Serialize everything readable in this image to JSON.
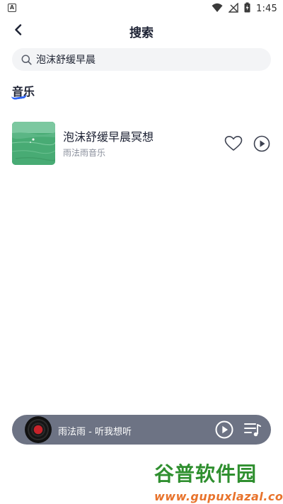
{
  "status_bar": {
    "left_icon_letter": "A",
    "time": "1:45",
    "icons": [
      "wifi-icon",
      "signal-off-icon",
      "battery-charging-icon"
    ]
  },
  "header": {
    "title": "搜索",
    "back_icon": "chevron-left-icon"
  },
  "search": {
    "value": "泡沫舒缓早晨",
    "icon": "search-icon"
  },
  "section": {
    "title": "音乐",
    "accent_color": "#2c63f6"
  },
  "results": [
    {
      "title": "泡沫舒缓早晨冥想",
      "artist": "雨法雨音乐",
      "actions": [
        "heart-icon",
        "play-circle-icon"
      ]
    }
  ],
  "mini_player": {
    "now_playing": "雨法雨 - 听我想听",
    "background": "#6d7384",
    "icons": [
      "vinyl-disc-icon",
      "play-circle-icon",
      "playlist-icon"
    ]
  },
  "watermark": {
    "logo": "谷普软件园",
    "url": "www.gupuxlazal.com"
  }
}
